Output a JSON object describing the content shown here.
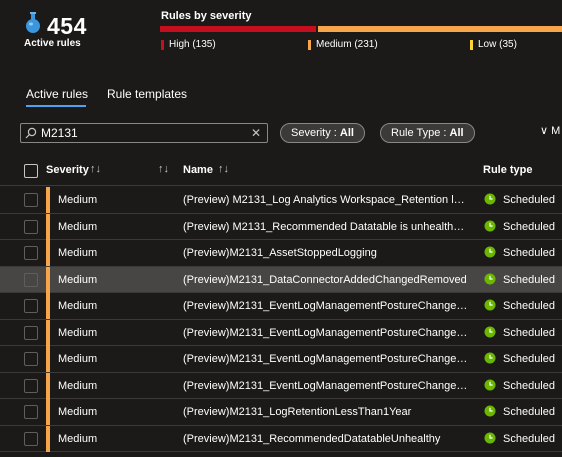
{
  "summary": {
    "count": "454",
    "label": "Active rules"
  },
  "severity": {
    "title": "Rules by severity",
    "high": "High (135)",
    "medium": "Medium (231)",
    "low": "Low (35)",
    "colors": {
      "high": "#c50f1f",
      "medium": "#f7a54a",
      "low": "#ffd335"
    }
  },
  "tabs": [
    {
      "label": "Active rules",
      "active": true
    },
    {
      "label": "Rule templates",
      "active": false
    }
  ],
  "filters": {
    "search_value": "M2131",
    "clear_glyph": "✕",
    "severity_label": "Severity : ",
    "severity_value": "All",
    "ruletype_label": "Rule Type : ",
    "ruletype_value": "All",
    "more_label": "∨ M"
  },
  "table": {
    "columns": {
      "severity": "Severity",
      "name": "Name",
      "rule_type": "Rule type",
      "sort_glyph": "↑↓"
    },
    "rows": [
      {
        "severity": "Medium",
        "name": "(Preview) M2131_Log Analytics Workspace_Retention less...",
        "type": "Scheduled"
      },
      {
        "severity": "Medium",
        "name": "(Preview) M2131_Recommended Datatable is unhealthy (l...",
        "type": "Scheduled"
      },
      {
        "severity": "Medium",
        "name": "(Preview)M2131_AssetStoppedLogging",
        "type": "Scheduled"
      },
      {
        "severity": "Medium",
        "name": "(Preview)M2131_DataConnectorAddedChangedRemoved",
        "type": "Scheduled"
      },
      {
        "severity": "Medium",
        "name": "(Preview)M2131_EventLogManagementPostureChanged_...",
        "type": "Scheduled"
      },
      {
        "severity": "Medium",
        "name": "(Preview)M2131_EventLogManagementPostureChanged_...",
        "type": "Scheduled"
      },
      {
        "severity": "Medium",
        "name": "(Preview)M2131_EventLogManagementPostureChanged_...",
        "type": "Scheduled"
      },
      {
        "severity": "Medium",
        "name": "(Preview)M2131_EventLogManagementPostureChanged_...",
        "type": "Scheduled"
      },
      {
        "severity": "Medium",
        "name": "(Preview)M2131_LogRetentionLessThan1Year",
        "type": "Scheduled"
      },
      {
        "severity": "Medium",
        "name": "(Preview)M2131_RecommendedDatatableUnhealthy",
        "type": "Scheduled"
      }
    ]
  }
}
